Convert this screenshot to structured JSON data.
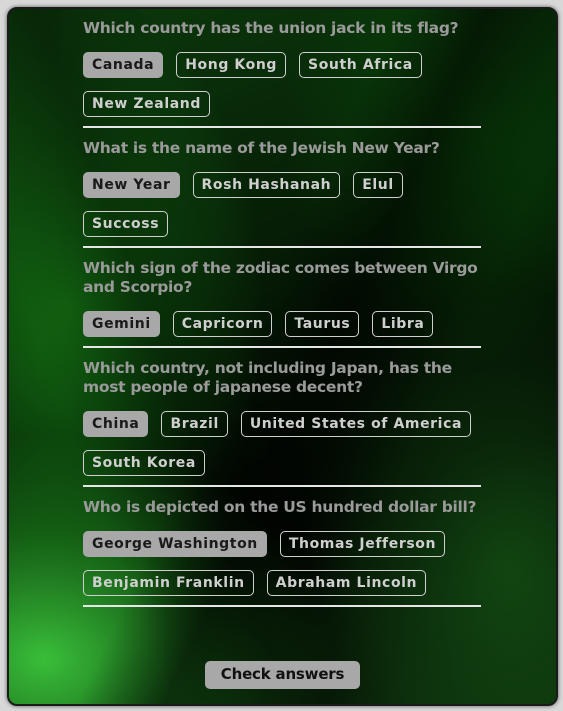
{
  "questions": [
    {
      "text": "Which country has the union jack in its flag?",
      "options": [
        "Canada",
        "Hong Kong",
        "South Africa",
        "New Zealand"
      ],
      "selected": 0
    },
    {
      "text": "What is the name of the Jewish New Year?",
      "options": [
        "New Year",
        "Rosh Hashanah",
        "Elul",
        "Succoss"
      ],
      "selected": 0
    },
    {
      "text": "Which sign of the zodiac comes between Virgo and Scorpio?",
      "options": [
        "Gemini",
        "Capricorn",
        "Taurus",
        "Libra"
      ],
      "selected": 0
    },
    {
      "text": "Which country, not including Japan, has the most people of japanese decent?",
      "options": [
        "China",
        "Brazil",
        "United States of America",
        "South Korea"
      ],
      "selected": 0
    },
    {
      "text": "Who is depicted on the US hundred dollar bill?",
      "options": [
        "George Washington",
        "Thomas Jefferson",
        "Benjamin Franklin",
        "Abraham Lincoln"
      ],
      "selected": 0
    }
  ],
  "check_button_label": "Check answers",
  "colors": {
    "selected_option_bg": "#a8a8a8",
    "option_border": "#cfcfcf",
    "question_text": "#9a9a9a",
    "background_green": "#2a9a2a"
  }
}
